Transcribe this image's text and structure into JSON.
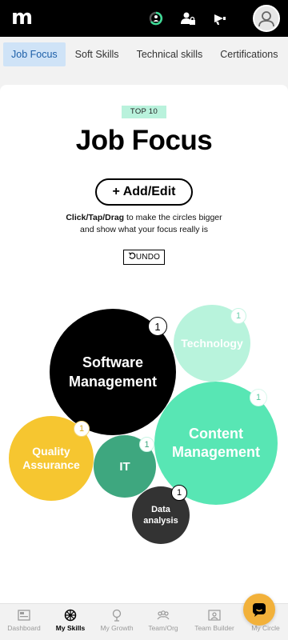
{
  "app": {
    "logo": "m"
  },
  "header": {
    "icons": [
      "progress-ring-icon",
      "user-lock-icon",
      "megaphone-icon",
      "avatar"
    ]
  },
  "tabs": [
    {
      "label": "Job Focus",
      "active": true
    },
    {
      "label": "Soft Skills",
      "active": false
    },
    {
      "label": "Technical skills",
      "active": false
    },
    {
      "label": "Certifications",
      "active": false
    }
  ],
  "main": {
    "badge": "TOP 10",
    "title": "Job Focus",
    "add_button": "+ Add/Edit",
    "instruction_bold": "Click/Tap/Drag",
    "instruction_rest_line1": " to make the circles bigger",
    "instruction_line2": "and show what your focus really is",
    "undo_label": "UNDO"
  },
  "bubbles": [
    {
      "label_line1": "Software",
      "label_line2": "Management",
      "count": "1",
      "color": "#000000",
      "text_color": "#ffffff"
    },
    {
      "label_line1": "Technology",
      "label_line2": "",
      "count": "1",
      "color": "#b8f3dc",
      "text_color": "#ffffff"
    },
    {
      "label_line1": "Content",
      "label_line2": "Management",
      "count": "1",
      "color": "#58e6b4",
      "text_color": "#ffffff"
    },
    {
      "label_line1": "Quality",
      "label_line2": "Assurance",
      "count": "1",
      "color": "#f6c630",
      "text_color": "#ffffff"
    },
    {
      "label_line1": "IT",
      "label_line2": "",
      "count": "1",
      "color": "#3ea77f",
      "text_color": "#ffffff"
    },
    {
      "label_line1": "Data",
      "label_line2": "analysis",
      "count": "1",
      "color": "#333333",
      "text_color": "#ffffff"
    }
  ],
  "bottom_nav": [
    {
      "label": "Dashboard",
      "icon": "dashboard-icon",
      "active": false
    },
    {
      "label": "My Skills",
      "icon": "skills-wheel-icon",
      "active": true
    },
    {
      "label": "My Growth",
      "icon": "growth-tree-icon",
      "active": false
    },
    {
      "label": "Team/Org",
      "icon": "team-icon",
      "active": false
    },
    {
      "label": "Team Builder",
      "icon": "team-builder-icon",
      "active": false
    },
    {
      "label": "My Circle",
      "icon": "circle-icon",
      "active": false
    }
  ],
  "chat": {
    "icon": "chat-icon",
    "color": "#f2b13a"
  }
}
